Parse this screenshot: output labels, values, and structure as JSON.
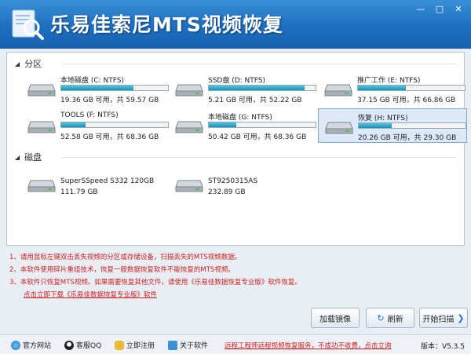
{
  "app": {
    "title": "乐易佳索尼MTS视频恢复"
  },
  "window": {
    "minimize": "—",
    "maximize": "□",
    "close": "✕"
  },
  "partitions": {
    "heading": "分区",
    "items": [
      {
        "name": "本地磁盘 (C: NTFS)",
        "info": "19.36 GB 可用，共 59.57 GB",
        "used_fraction": 0.68,
        "selected": false
      },
      {
        "name": "SSD盘 (D: NTFS)",
        "info": "5.21 GB 可用，共 52.22 GB",
        "used_fraction": 0.9,
        "selected": false
      },
      {
        "name": "推广工作 (E: NTFS)",
        "info": "37.15 GB 可用，共 66.86 GB",
        "used_fraction": 0.45,
        "selected": false
      },
      {
        "name": "TOOLS (F: NTFS)",
        "info": "52.58 GB 可用，共 68.36 GB",
        "used_fraction": 0.23,
        "selected": false
      },
      {
        "name": "本地磁盘 (G: NTFS)",
        "info": "50.42 GB 可用，共 68.36 GB",
        "used_fraction": 0.26,
        "selected": false
      },
      {
        "name": "恢复 (H: NTFS)",
        "info": "20.26 GB 可用，共 29.30 GB",
        "used_fraction": 0.31,
        "selected": true
      }
    ]
  },
  "disks": {
    "heading": "磁盘",
    "items": [
      {
        "name": "SuperSSpeed S332 120GB",
        "info": "111.79 GB"
      },
      {
        "name": "ST9250315AS",
        "info": "232.89 GB"
      }
    ]
  },
  "notes": {
    "line1": "1、请用鼠标左键双击丢失视频的分区或存储设备，扫描丢失的MTS视频数据。",
    "line2": "2、本软件使用碎片重组技术，恢复一般数据恢复软件不能恢复的MTS视频。",
    "line3": "3、本软件只恢复MTS视频。如果需要恢复其他文件，请使用《乐易佳数据恢复专业版》软件恢复。",
    "link": "点击立即下载《乐易佳数据恢复专业版》软件"
  },
  "buttons": {
    "load_image": "加载镜像",
    "refresh": "刷新",
    "start_scan": "开始扫描"
  },
  "statusbar": {
    "website": "官方网站",
    "qq": "客服QQ",
    "register": "立即注册",
    "about": "关于软件",
    "notice": "远程工程师远程视频恢复服务，不成功不收费，点击立询",
    "version": "版本：V5.3.5"
  },
  "colors": {
    "accent": "#1d6fbf",
    "warning_text": "#cc1f1f",
    "bar_fill": "#1a8fb6"
  }
}
